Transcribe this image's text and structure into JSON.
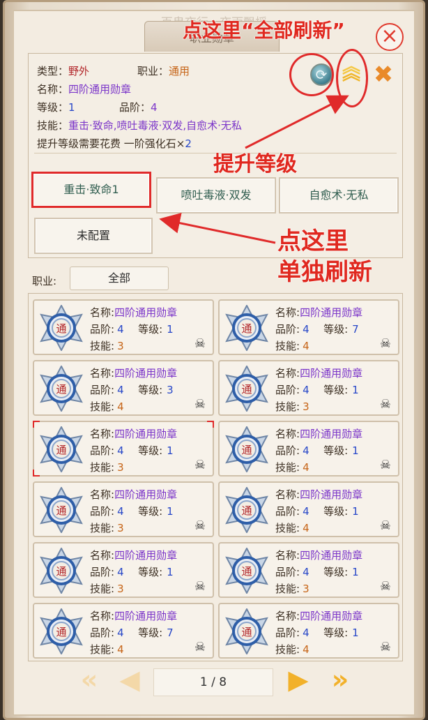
{
  "faded_title": "百鬼夜行 · 夜雨飘摇",
  "tab_title": "职业勋章",
  "detail": {
    "type_label": "类型：",
    "type_value": "野外",
    "job_label": "职业：",
    "job_value": "通用",
    "name_label": "名称：",
    "name_value": "四阶通用勋章",
    "level_label": "等级：",
    "level_value": "1",
    "grade_label": "品阶：",
    "grade_value": "4",
    "skill_label": "技能：",
    "skill_value": "重击·致命,喷吐毒液·双发,自愈术·无私",
    "cost_text": "提升等级需要花费 一阶强化石×",
    "cost_value": "2"
  },
  "skill_buttons": [
    "重击·致命1",
    "喷吐毒液·双发",
    "自愈术·无私",
    "未配置"
  ],
  "annotations": {
    "refresh_all": "点这里“全部刷新”",
    "upgrade": "提升等级",
    "single_refresh_1": "点这里",
    "single_refresh_2": "单独刷新"
  },
  "filter": {
    "label": "职业:",
    "value": "全部"
  },
  "card_labels": {
    "name": "名称:",
    "grade": "品阶:",
    "level": "等级:",
    "skill": "技能:",
    "badge_char": "通"
  },
  "cards": [
    {
      "name": "四阶通用勋章",
      "grade": "4",
      "level": "1",
      "skill": "3"
    },
    {
      "name": "四阶通用勋章",
      "grade": "4",
      "level": "7",
      "skill": "4"
    },
    {
      "name": "四阶通用勋章",
      "grade": "4",
      "level": "3",
      "skill": "4"
    },
    {
      "name": "四阶通用勋章",
      "grade": "4",
      "level": "1",
      "skill": "3"
    },
    {
      "name": "四阶通用勋章",
      "grade": "4",
      "level": "1",
      "skill": "3"
    },
    {
      "name": "四阶通用勋章",
      "grade": "4",
      "level": "1",
      "skill": "4"
    },
    {
      "name": "四阶通用勋章",
      "grade": "4",
      "level": "1",
      "skill": "3"
    },
    {
      "name": "四阶通用勋章",
      "grade": "4",
      "level": "1",
      "skill": "4"
    },
    {
      "name": "四阶通用勋章",
      "grade": "4",
      "level": "1",
      "skill": "3"
    },
    {
      "name": "四阶通用勋章",
      "grade": "4",
      "level": "1",
      "skill": "3"
    },
    {
      "name": "四阶通用勋章",
      "grade": "4",
      "level": "7",
      "skill": "4"
    },
    {
      "name": "四阶通用勋章",
      "grade": "4",
      "level": "1",
      "skill": "4"
    }
  ],
  "pager": {
    "page_text": "1 / 8"
  },
  "icons": {
    "close": "close-icon",
    "refresh": "refresh-icon",
    "upgrade": "upgrade-chevron-icon",
    "delete": "delete-x-icon",
    "skull": "skull-icon",
    "first": "double-chevron-left-icon",
    "prev": "chevron-left-icon",
    "next": "chevron-right-icon",
    "last": "double-chevron-right-icon"
  },
  "colors": {
    "annotation_red": "#e0281f",
    "name_purple": "#7b35c9",
    "number_blue": "#2747c8",
    "skill_orange": "#c66417"
  }
}
